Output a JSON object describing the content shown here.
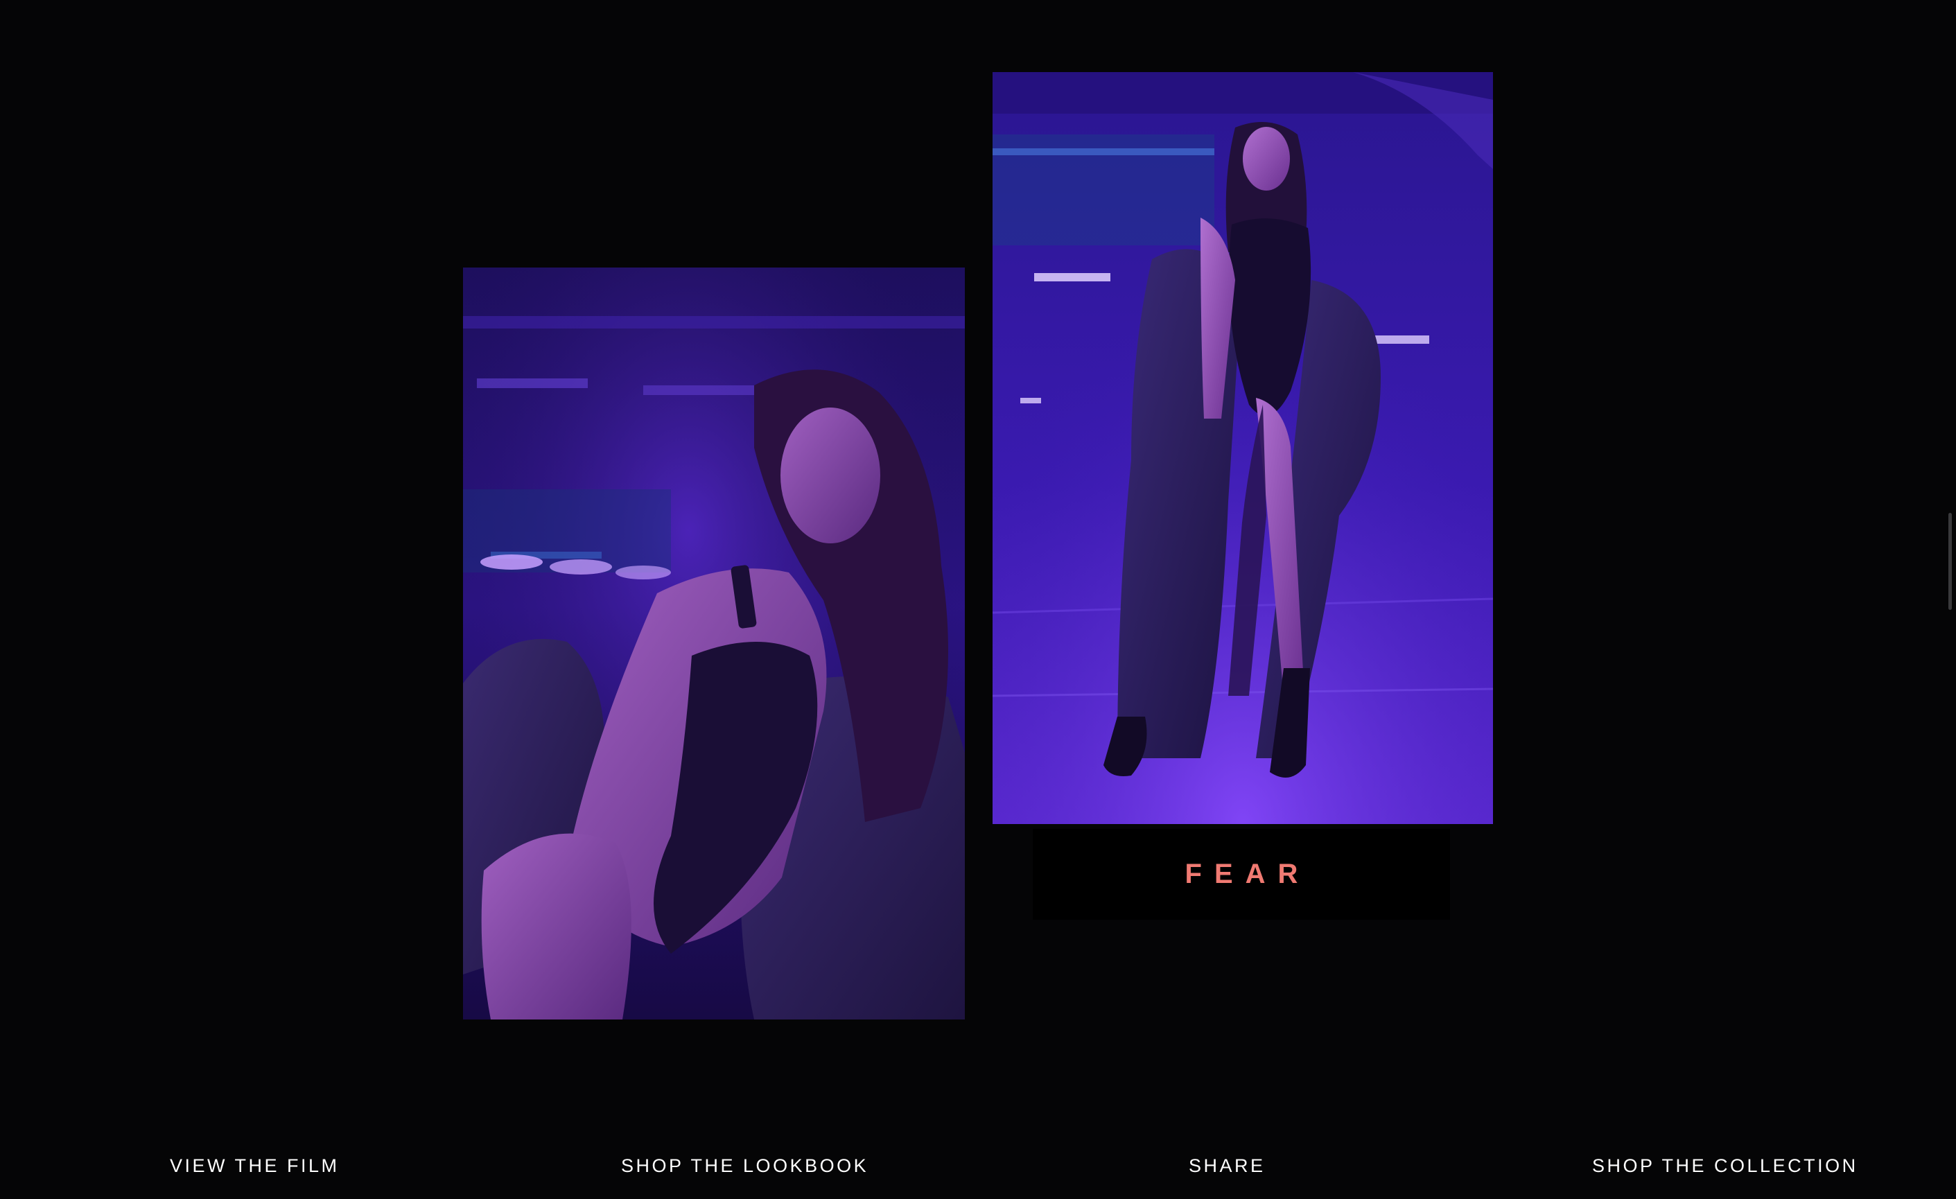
{
  "feature": {
    "caption": "FEAR"
  },
  "photos": {
    "left_icon": "model-portrait-photo",
    "right_icon": "model-full-length-photo",
    "tone_colors": {
      "deep": "#1a0b4a",
      "mid": "#3c1aa8",
      "glow": "#7a3cff",
      "skin": "#8a4a9a"
    }
  },
  "nav": {
    "view_film": "VIEW THE FILM",
    "shop_lookbook": "SHOP THE LOOKBOOK",
    "share": "SHARE",
    "shop_collection": "SHOP THE COLLECTION"
  },
  "colors": {
    "background": "#050506",
    "caption_accent": "#f07a72",
    "nav_text": "#ffffff"
  }
}
